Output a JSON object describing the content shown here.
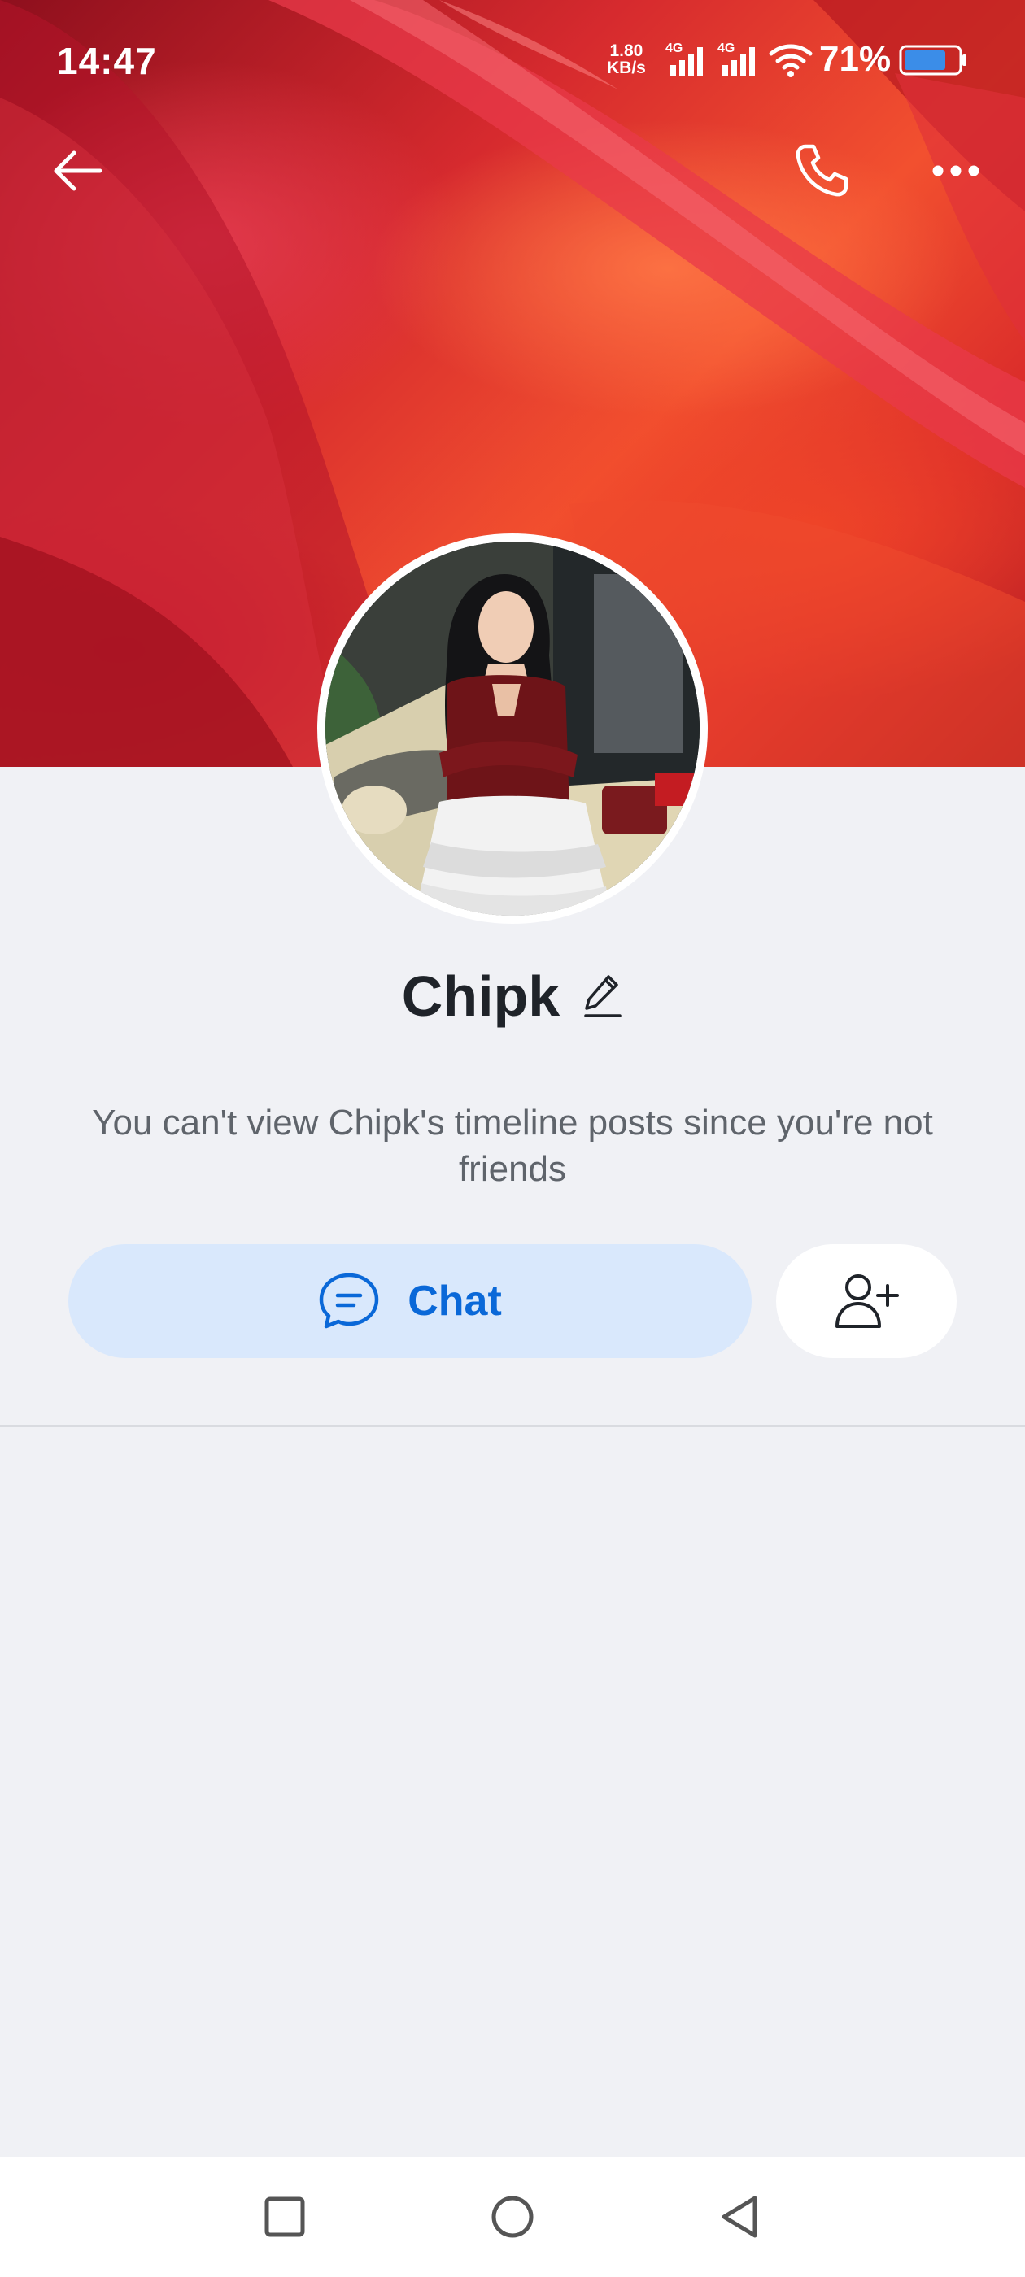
{
  "status_bar": {
    "time": "14:47",
    "net_speed_value": "1.80",
    "net_speed_unit": "KB/s",
    "signal1_label": "4G",
    "signal2_label": "4G",
    "battery_percent": "71%"
  },
  "top_bar": {
    "back_icon": "arrow-left-icon",
    "call_icon": "phone-icon",
    "more_icon": "more-horizontal-icon"
  },
  "profile": {
    "name": "Chipk",
    "edit_icon": "pencil-icon",
    "notice": "You can't view Chipk's timeline posts since you're not friends"
  },
  "actions": {
    "chat_label": "Chat",
    "chat_icon": "chat-bubble-icon",
    "add_friend_icon": "add-user-icon"
  },
  "colors": {
    "accent": "#0a68d8",
    "chat_button_bg": "#d9e8fc",
    "page_bg": "#f0f1f5"
  },
  "nav_bar": {
    "recent_icon": "square-icon",
    "home_icon": "circle-icon",
    "back_icon": "triangle-back-icon"
  }
}
